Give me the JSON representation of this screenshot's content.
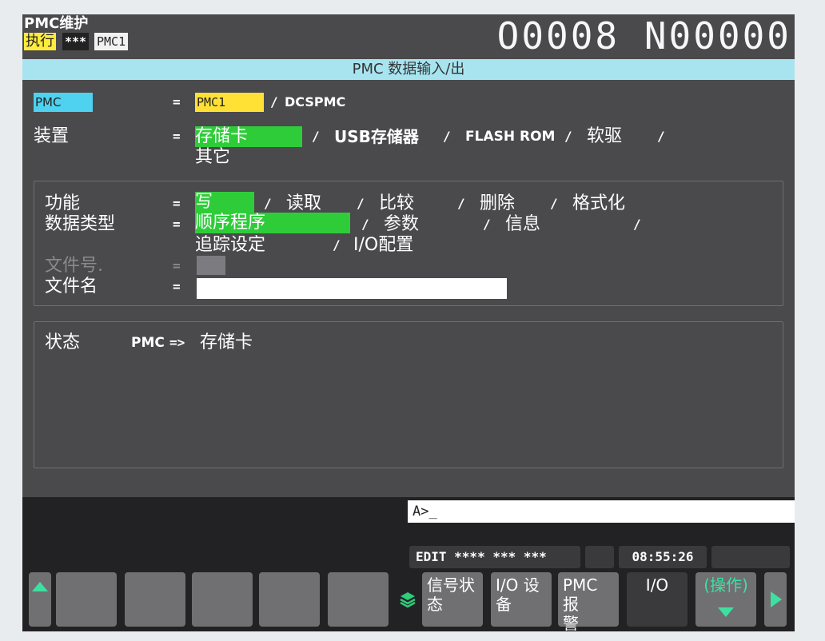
{
  "header": {
    "mode": "PMC维护",
    "exec": "执行",
    "stars": "***",
    "path": "PMC1",
    "program": "O0008 N00000",
    "title": "PMC 数据输入/出"
  },
  "form": {
    "pmc": {
      "label": "PMC",
      "eq": "=",
      "value": "PMC1",
      "sep": "/",
      "alt": "DCSPMC"
    },
    "device": {
      "label": "装置",
      "eq": "=",
      "selected": "存储卡",
      "options": [
        "USB存储器",
        "FLASH ROM",
        "软驱",
        "其它"
      ],
      "sep": "/"
    },
    "function": {
      "label": "功能",
      "eq": "=",
      "selected": "写",
      "options": [
        "读取",
        "比较",
        "删除",
        "格式化"
      ]
    },
    "datatype": {
      "label": "数据类型",
      "eq": "=",
      "selected": "顺序程序",
      "options": [
        "参数",
        "信息",
        "追踪设定",
        "I/O配置"
      ]
    },
    "fileno": {
      "label": "文件号.",
      "eq": "="
    },
    "filename": {
      "label": "文件名",
      "eq": "=",
      "value": ""
    }
  },
  "status": {
    "label": "状态",
    "source": "PMC",
    "arrow": "=>",
    "target": "存储卡"
  },
  "command": {
    "prompt": "A>_"
  },
  "statusbar": {
    "mode": "EDIT **** *** ***",
    "time": "08:55:26"
  },
  "softkeys": [
    {
      "label": "信号状态",
      "line1": "信号状",
      "line2": "态"
    },
    {
      "label": "I/O 设备",
      "line1": "I/O 设",
      "line2": "备"
    },
    {
      "label": "PMC 报警",
      "line1": "PMC 报",
      "line2": "警"
    },
    {
      "label": "I/O",
      "line1": "I/O",
      "line2": ""
    },
    {
      "label": "(操作)",
      "line1": "(操作)",
      "line2": ""
    }
  ],
  "colors": {
    "cyan": "#4fd1f0",
    "yellow": "#ffe135",
    "green": "#2fcc3a",
    "background": "#4a4a4c",
    "title_bar": "#a8e4f0"
  }
}
